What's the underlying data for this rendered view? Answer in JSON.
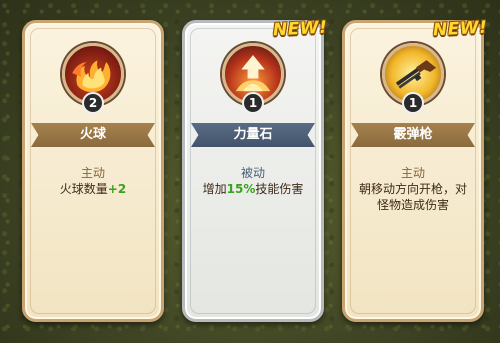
{
  "cards": [
    {
      "name": "火球",
      "type": "主动",
      "desc_before": "火球数量",
      "desc_highlight": "+2",
      "desc_after": "",
      "level": "2",
      "is_new": false,
      "icon": "fireball-icon"
    },
    {
      "name": "力量石",
      "type": "被动",
      "desc_before": "增加",
      "desc_highlight": "15%",
      "desc_after": "技能伤害",
      "level": "1",
      "is_new": true,
      "new_label": "NEW!",
      "icon": "power-stone-icon"
    },
    {
      "name": "霰弹枪",
      "type": "主动",
      "desc_before": "朝移动方向开枪，对怪物造成伤害",
      "desc_highlight": "",
      "desc_after": "",
      "level": "1",
      "is_new": true,
      "new_label": "NEW!",
      "icon": "shotgun-icon"
    }
  ],
  "colors": {
    "active_ribbon": "#9a7646",
    "passive_ribbon": "#4e5f78",
    "highlight": "#38a21e",
    "new_badge": "#ffd92e"
  }
}
